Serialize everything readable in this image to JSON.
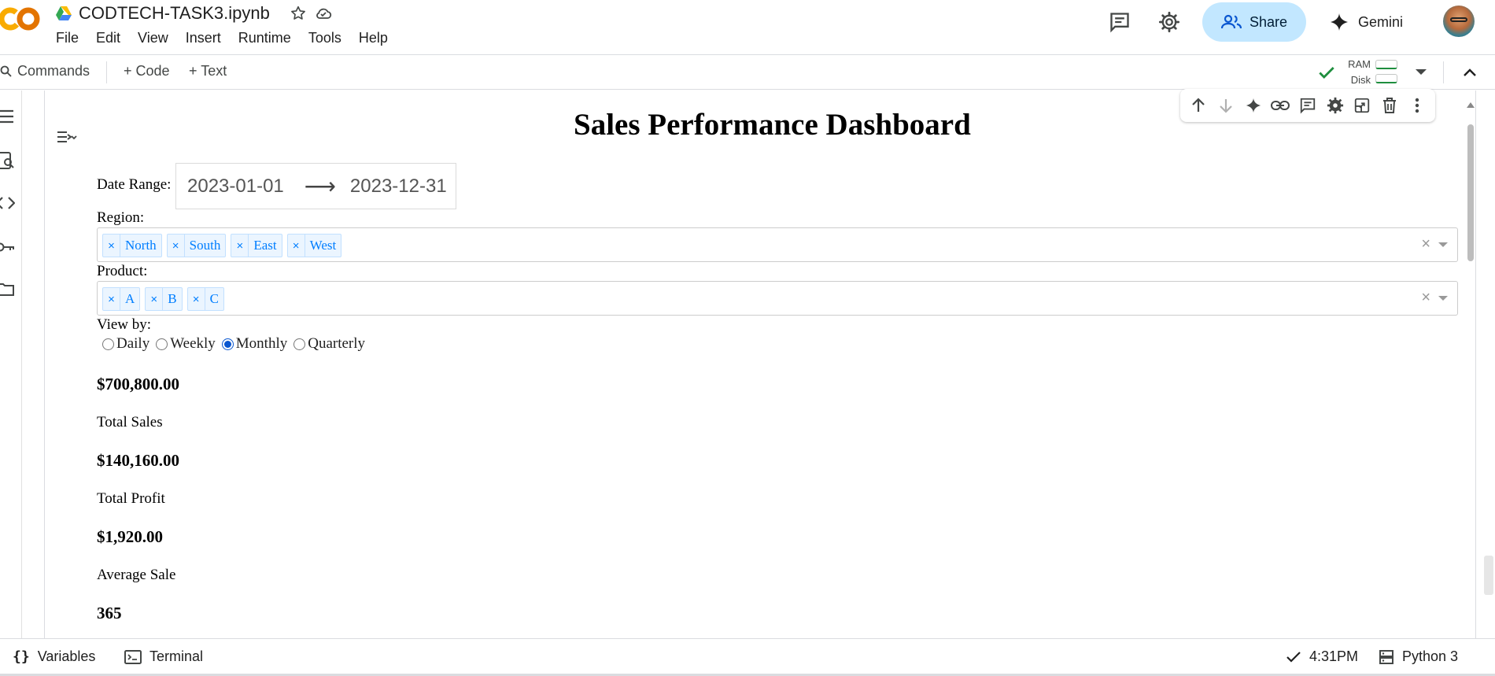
{
  "app": {
    "logo_text": "CO",
    "notebook_title": "CODTECH-TASK3.ipynb",
    "menu": [
      "File",
      "Edit",
      "View",
      "Insert",
      "Runtime",
      "Tools",
      "Help"
    ],
    "share_label": "Share",
    "gemini_label": "Gemini"
  },
  "toolbar": {
    "commands_label": "Commands",
    "code_label": "+ Code",
    "text_label": "+ Text",
    "ram_label": "RAM",
    "disk_label": "Disk"
  },
  "dashboard": {
    "title": "Sales Performance Dashboard",
    "date_range_label": "Date Range:",
    "start_date": "2023-01-01",
    "arrow": "⟶",
    "end_date": "2023-12-31",
    "region_label": "Region:",
    "regions": [
      "North",
      "South",
      "East",
      "West"
    ],
    "product_label": "Product:",
    "products": [
      "A",
      "B",
      "C"
    ],
    "chip_remove": "×",
    "clear_all": "×",
    "view_by_label": "View by:",
    "view_options": [
      "Daily",
      "Weekly",
      "Monthly",
      "Quarterly"
    ],
    "view_selected": "Monthly",
    "kpis": [
      {
        "value": "$700,800.00",
        "label": "Total Sales"
      },
      {
        "value": "$140,160.00",
        "label": "Total Profit"
      },
      {
        "value": "$1,920.00",
        "label": "Average Sale"
      },
      {
        "value": "365",
        "label": ""
      }
    ]
  },
  "statusbar": {
    "variables_label": "Variables",
    "terminal_label": "Terminal",
    "time": "4:31PM",
    "runtime": "Python 3"
  },
  "colors": {
    "accent": "#0b57d0",
    "share_bg": "#c2e7ff",
    "chip_bg": "#ebf5ff",
    "chip_text": "#007eff",
    "logo_orange": "#f9ab00",
    "logo_dark_orange": "#e37400",
    "ok_green": "#1e8e3e"
  }
}
